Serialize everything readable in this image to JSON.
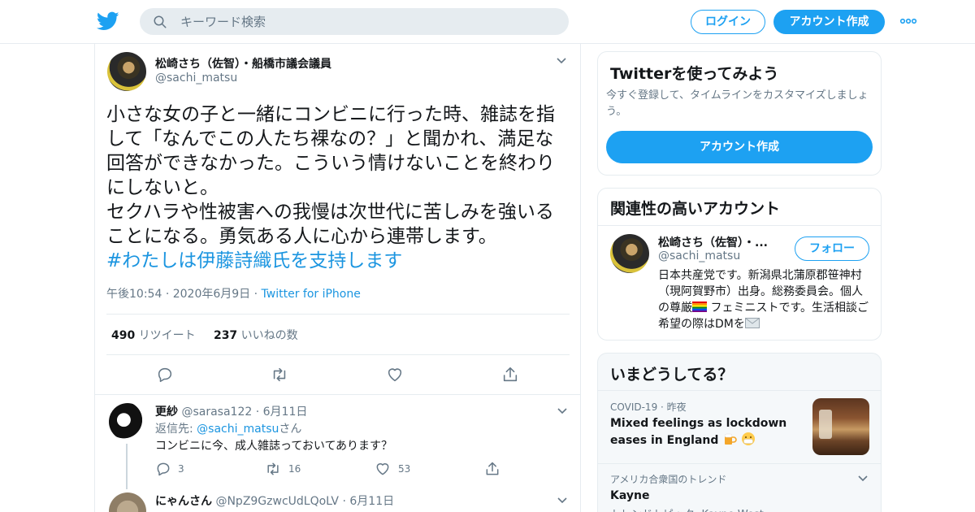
{
  "header": {
    "search_placeholder": "キーワード検索",
    "login_label": "ログイン",
    "signup_label": "アカウント作成"
  },
  "tweet": {
    "author_name": "松崎さち（佐智）・船橋市議会議員",
    "author_handle": "@sachi_matsu",
    "text": "小さな女の子と一緒にコンビニに行った時、雑誌を指して「なんでこの人たち裸なの？」と聞かれ、満足な回答ができなかった。こういう情けないことを終わりにしないと。\nセクハラや性被害への我慢は次世代に苦しみを強いることになる。勇気ある人に心から連帯します。",
    "hashtag": "#わたしは伊藤詩織氏を支持します",
    "time": "午後10:54",
    "date": "2020年6月9日",
    "source": "Twitter for iPhone",
    "retweet_count": "490",
    "retweet_label": "リツイート",
    "like_count": "237",
    "like_label": "いいねの数"
  },
  "replies": [
    {
      "name": "更紗",
      "handle": "@sarasa122",
      "date": "6月11日",
      "reply_to_prefix": "返信先:",
      "reply_to_handle": "@sachi_matsu",
      "reply_to_suffix": "さん",
      "text": "コンビニに今、成人雑誌っておいてあります？",
      "reply_count": "3",
      "retweet_count": "16",
      "like_count": "53"
    },
    {
      "name": "にゃんさん",
      "handle": "@NpZ9GzwcUdLQoLV",
      "date": "6月11日"
    }
  ],
  "sidebar": {
    "signup_card": {
      "title": "Twitterを使ってみよう",
      "description": "今すぐ登録して、タイムラインをカスタマイズしましょう。",
      "button_label": "アカウント作成"
    },
    "related": {
      "title": "関連性の高いアカウント",
      "name": "松崎さち（佐智）・...",
      "handle": "@sachi_matsu",
      "follow_label": "フォロー",
      "bio_part1": "日本共産党です。新潟県北蒲原郡笹神村（現阿賀野市）出身。総務委員会。個人の尊厳",
      "bio_part2": " フェミニストです。生活相談ご希望の際はDMを"
    },
    "trends": {
      "title": "いまどうしてる？",
      "items": [
        {
          "category": "COVID-19",
          "time": "昨夜",
          "topic": "Mixed feelings as lockdown eases in England"
        },
        {
          "category": "アメリカ合衆国のトレンド",
          "topic": "Kayne",
          "subtitle": "トレンドトピック: Kayne West"
        }
      ]
    }
  },
  "colors": {
    "accent": "#1da1f2",
    "link": "#1b95e0",
    "muted": "#657786",
    "border": "#e6ecf0"
  }
}
